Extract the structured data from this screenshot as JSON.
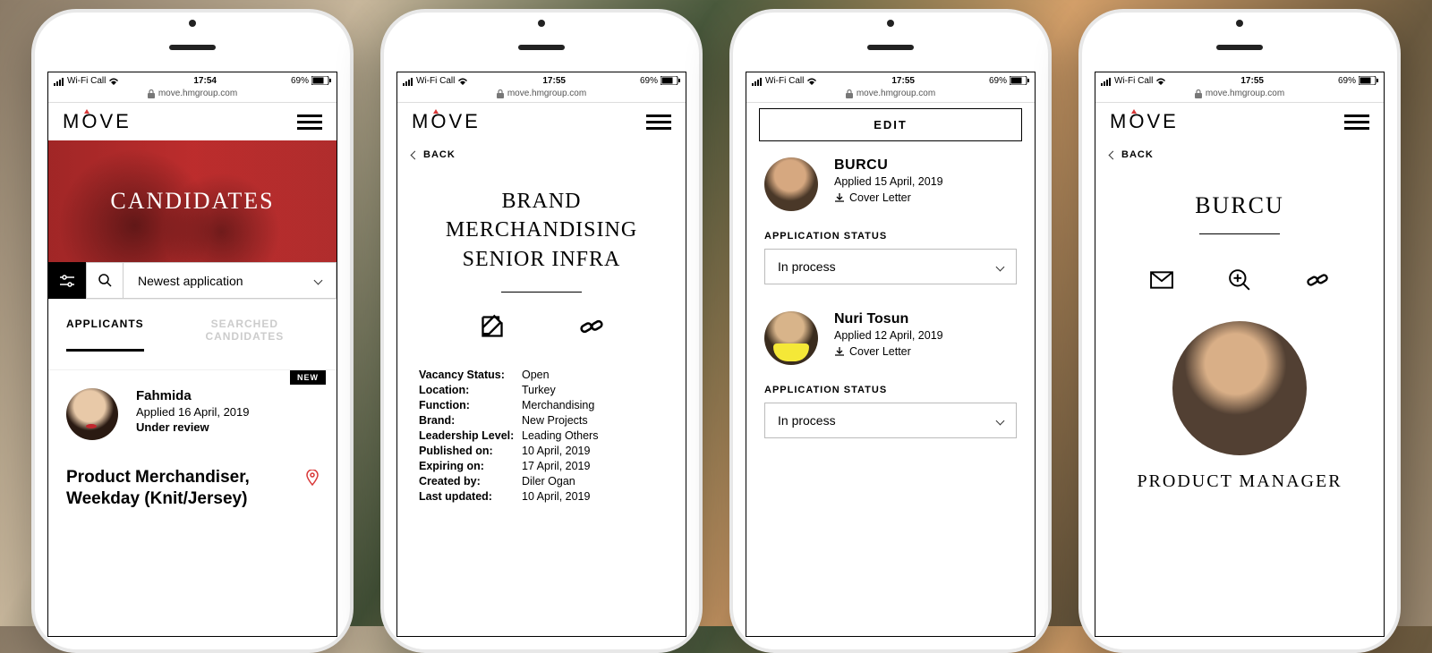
{
  "status_bar": {
    "carrier": "Wi-Fi Call",
    "wifi": true,
    "times": [
      "17:54",
      "17:55",
      "17:55",
      "17:55"
    ],
    "battery": "69%"
  },
  "url": "move.hmgroup.com",
  "logo": "MOVE",
  "screen1": {
    "hero_title": "CANDIDATES",
    "sort_label": "Newest application",
    "tabs": {
      "active": "APPLICANTS",
      "inactive": "SEARCHED CANDIDATES"
    },
    "new_badge": "NEW",
    "candidate": {
      "name": "Fahmida",
      "applied": "Applied 16 April, 2019",
      "status": "Under review"
    },
    "job": "Product Merchandiser, Weekday (Knit/Jersey)"
  },
  "back": "BACK",
  "screen2": {
    "title": "BRAND MERCHANDISING SENIOR INFRA",
    "details": [
      {
        "label": "Vacancy Status:",
        "value": "Open"
      },
      {
        "label": "Location:",
        "value": "Turkey"
      },
      {
        "label": "Function:",
        "value": "Merchandising"
      },
      {
        "label": "Brand:",
        "value": "New Projects"
      },
      {
        "label": "Leadership Level:",
        "value": "Leading Others"
      },
      {
        "label": "Published on:",
        "value": "10 April, 2019"
      },
      {
        "label": "Expiring on:",
        "value": "17 April, 2019"
      },
      {
        "label": "Created by:",
        "value": "Diler Ogan"
      },
      {
        "label": "Last updated:",
        "value": "10 April, 2019"
      }
    ]
  },
  "screen3": {
    "edit": "EDIT",
    "status_label": "APPLICATION STATUS",
    "status_value": "In process",
    "cover_letter": "Cover Letter",
    "applicants": [
      {
        "name": "BURCU",
        "date": "Applied 15 April, 2019"
      },
      {
        "name": "Nuri Tosun",
        "date": "Applied 12 April, 2019"
      }
    ]
  },
  "screen4": {
    "name": "BURCU",
    "role": "PRODUCT MANAGER"
  }
}
